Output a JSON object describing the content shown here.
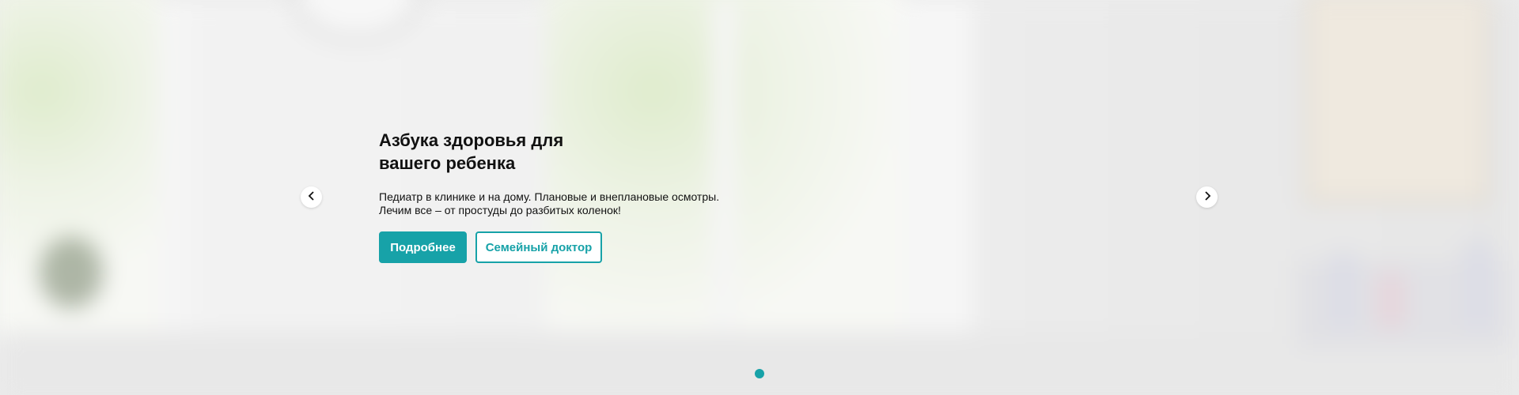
{
  "slide": {
    "title": "Азбука здоровья для вашего ребенка",
    "subtitle": "Педиатр в клинике и на дому. Плановые и внеплановые осмотры. Лечим все – от простуды до разбитых коленок!",
    "primary_button": "Подробнее",
    "secondary_button": "Семейный доктор"
  },
  "carousel": {
    "prev_icon": "chevron-left-icon",
    "next_icon": "chevron-right-icon",
    "dots": [
      {
        "active": true
      }
    ]
  },
  "colors": {
    "accent": "#17a2a8",
    "text": "#111111",
    "button_text_primary": "#ffffff"
  }
}
